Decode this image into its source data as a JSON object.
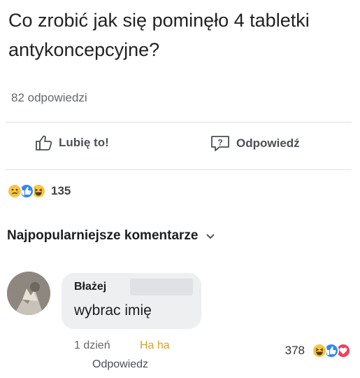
{
  "post": {
    "question": "Co zrobić jak się pominęło 4 tabletki antykoncepcyjne?",
    "answers_count": "82 odpowiedzi"
  },
  "actions": {
    "like_label": "Lubię to!",
    "reply_label": "Odpowiedź"
  },
  "reactions": {
    "icons": [
      "sad-reaction-icon",
      "like-reaction-icon",
      "haha-reaction-icon"
    ],
    "count": "135"
  },
  "comments_section": {
    "sort_label": "Najpopularniejsze komentarze"
  },
  "comment": {
    "author": "Błażej",
    "text": "wybrac imię",
    "time": "1 dzień",
    "haha_label": "Ha ha",
    "reply_label": "Odpowiedz",
    "reaction_count": "378",
    "reaction_icons": [
      "haha-reaction-icon",
      "like-reaction-icon",
      "love-reaction-icon"
    ]
  },
  "colors": {
    "like_blue": "#2d88ff",
    "haha_yellow": "#f7c544",
    "love_red": "#f33e58",
    "muted_text": "#65676b"
  }
}
